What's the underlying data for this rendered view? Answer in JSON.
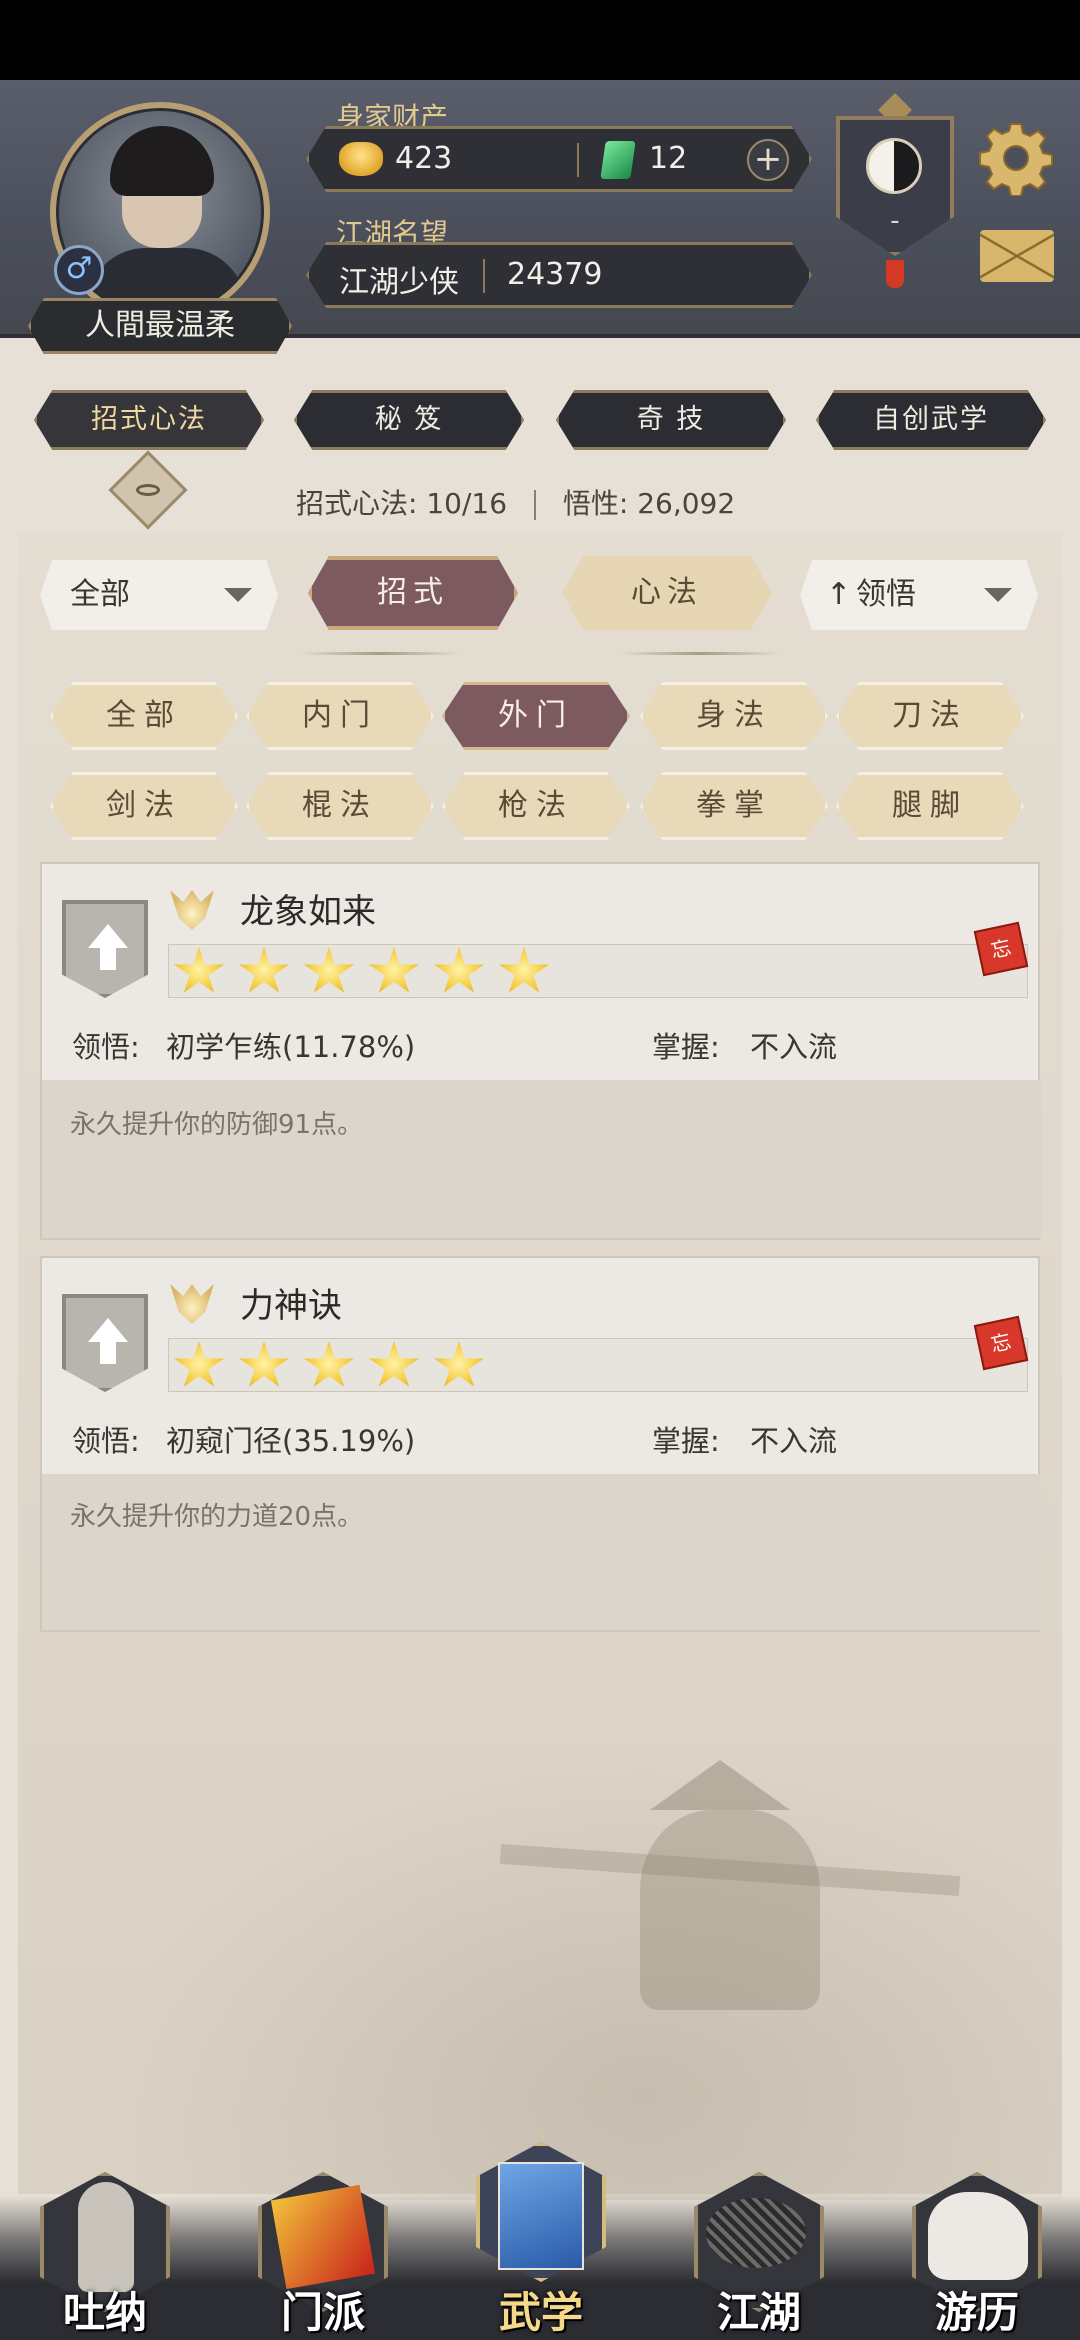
{
  "header": {
    "player_name": "人間最温柔",
    "gender_symbol": "♂",
    "wealth_label": "身家财产",
    "gold": "423",
    "jade": "12",
    "plus": "+",
    "reputation_label": "江湖名望",
    "reputation_title": "江湖少侠",
    "reputation_value": "24379",
    "sect_badge_value": "-"
  },
  "tabs": [
    "招式心法",
    "秘 笈",
    "奇 技",
    "自创武学"
  ],
  "stats": {
    "moves_label": "招式心法:",
    "moves_value": "10/16",
    "insight_label": "悟性:",
    "insight_value": "26,092"
  },
  "filters": {
    "left_dropdown": "全部",
    "toggle_moves": "招式",
    "toggle_mind": "心法",
    "sort_dropdown": "领悟"
  },
  "categories": [
    "全部",
    "内门",
    "外门",
    "身法",
    "刀法",
    "剑法",
    "棍法",
    "枪法",
    "拳掌",
    "腿脚"
  ],
  "active_category": "外门",
  "skills": [
    {
      "name": "龙象如来",
      "stars": 6,
      "comprehension_label": "领悟:",
      "comprehension": "初学乍练(11.78%)",
      "mastery_label": "掌握:",
      "mastery": "不入流",
      "description": "永久提升你的防御91点。",
      "seal": "忘"
    },
    {
      "name": "力神诀",
      "stars": 5,
      "comprehension_label": "领悟:",
      "comprehension": "初窥门径(35.19%)",
      "mastery_label": "掌握:",
      "mastery": "不入流",
      "description": "永久提升你的力道20点。",
      "seal": "忘"
    }
  ],
  "bottom_nav": [
    "吐纳",
    "门派",
    "武学",
    "江湖",
    "游历"
  ],
  "active_nav": "武学",
  "colors": {
    "accent_active": "#7c5a60",
    "chip_inactive": "#e8d9b8",
    "header_bg": "#4b4f5b",
    "gold_text": "#e2c98f"
  }
}
